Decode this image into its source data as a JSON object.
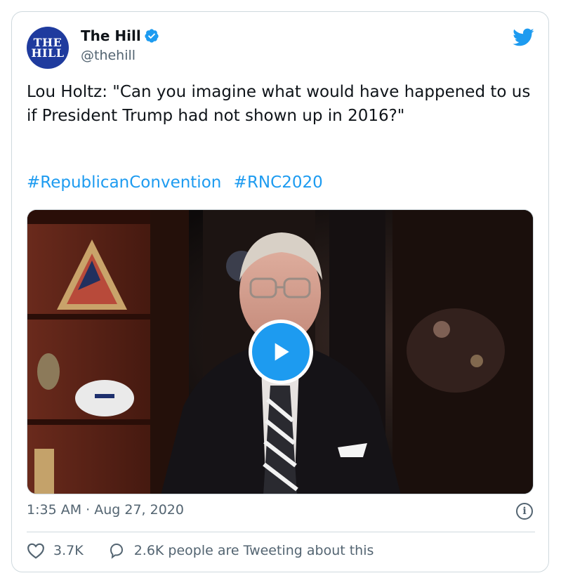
{
  "author": {
    "avatar_text_line1": "THE",
    "avatar_text_line2": "HILL",
    "display_name": "The Hill",
    "handle": "@thehill",
    "verified_icon": "verified-badge-icon"
  },
  "tweet": {
    "text": "Lou Holtz: \"Can you imagine what would have happened to us if President Trump had not shown up in 2016?\"",
    "hashtags": [
      "#RepublicanConvention",
      "#RNC2020"
    ],
    "timestamp": "1:35 AM · Aug 27, 2020"
  },
  "media": {
    "type": "video",
    "play_icon": "play-icon"
  },
  "footer": {
    "likes_count": "3.7K",
    "conversation_label": "2.6K people are Tweeting about this",
    "info_icon_glyph": "i"
  },
  "colors": {
    "brand_blue": "#1d9bf0",
    "avatar_blue": "#1f3b9e",
    "secondary_text": "#536471",
    "border": "#cfd9de"
  }
}
